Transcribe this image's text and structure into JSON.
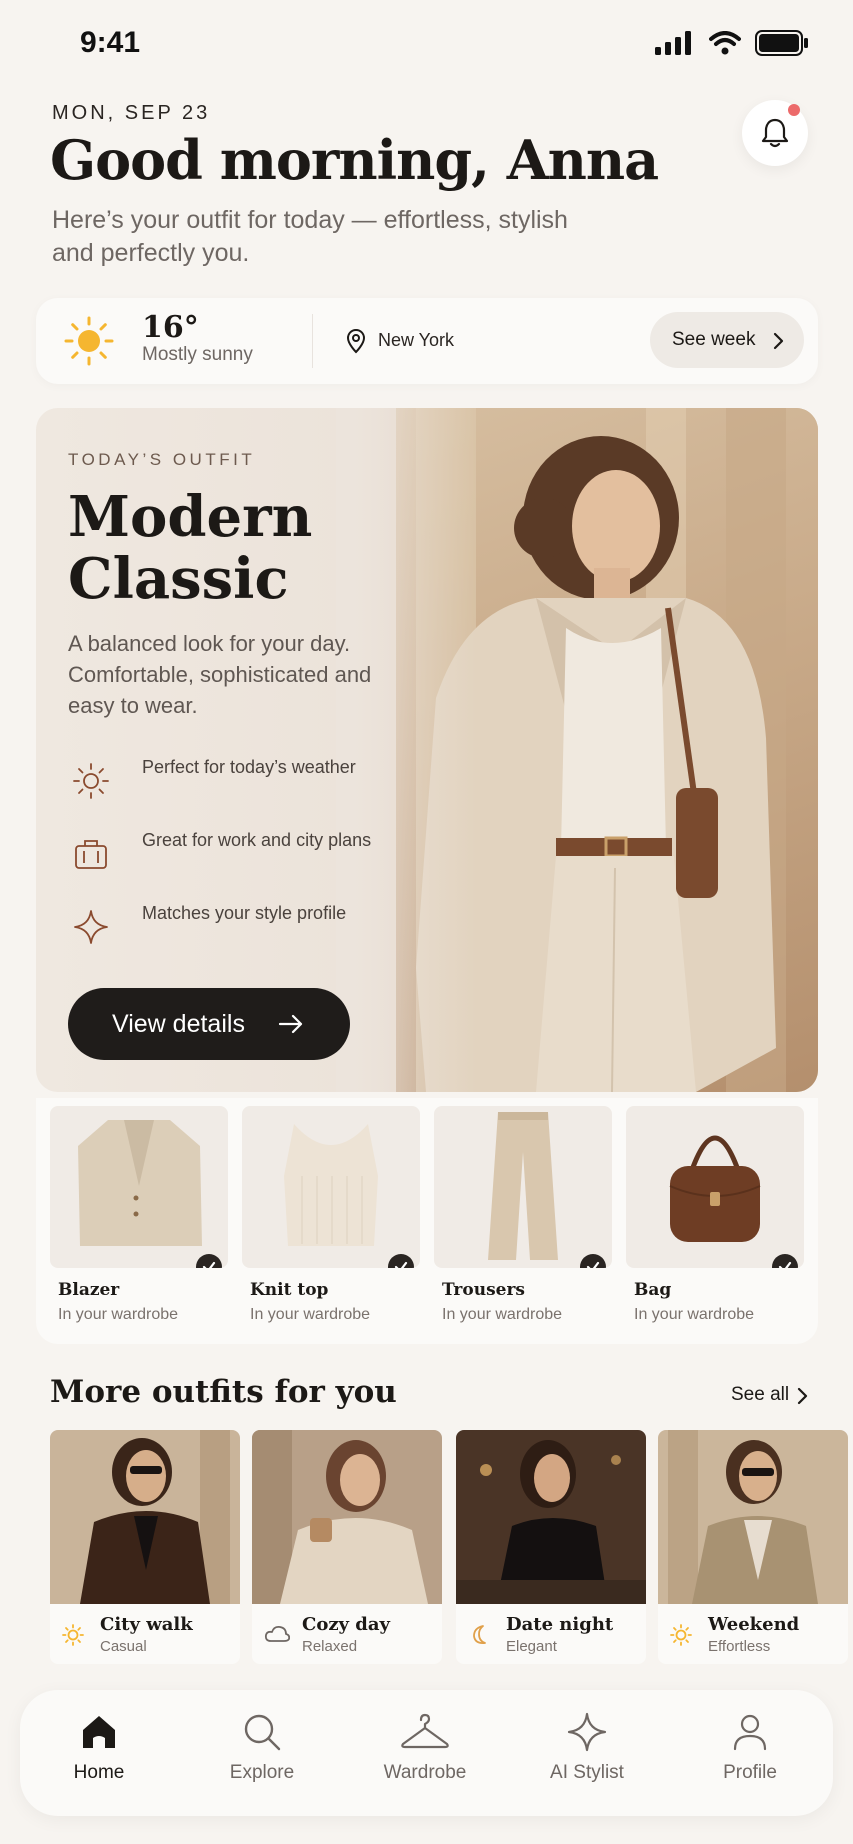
{
  "status_bar": {
    "time": "9:41"
  },
  "header": {
    "date": "MON, SEP 23",
    "greeting": "Good morning, Anna",
    "subtitle": "Here’s your outfit for today — effortless, stylish and perfectly you."
  },
  "weather": {
    "temperature": "16°",
    "condition": "Mostly sunny",
    "location": "New York",
    "see_week_label": "See week"
  },
  "todays_outfit": {
    "eyebrow": "TODAY’S OUTFIT",
    "name": "Modern Classic",
    "description": "A balanced look for your day. Comfortable, sophisticated and easy to wear.",
    "features": [
      {
        "icon": "sun-icon",
        "text": "Perfect for today’s weather"
      },
      {
        "icon": "briefcase-icon",
        "text": "Great for work and city plans"
      },
      {
        "icon": "sparkle-icon",
        "text": "Matches your style profile"
      }
    ],
    "cta_label": "View details"
  },
  "wardrobe_items": [
    {
      "name": "Blazer",
      "status": "In your wardrobe"
    },
    {
      "name": "Knit top",
      "status": "In your wardrobe"
    },
    {
      "name": "Trousers",
      "status": "In your wardrobe"
    },
    {
      "name": "Bag",
      "status": "In your wardrobe"
    }
  ],
  "more_outfits": {
    "title": "More outfits for you",
    "see_all_label": "See all",
    "items": [
      {
        "title": "City walk",
        "subtitle": "Casual",
        "icon": "sun-icon"
      },
      {
        "title": "Cozy day",
        "subtitle": "Relaxed",
        "icon": "cloud-icon"
      },
      {
        "title": "Date night",
        "subtitle": "Elegant",
        "icon": "moon-icon"
      },
      {
        "title": "Weekend",
        "subtitle": "Effortless",
        "icon": "sun-icon"
      }
    ]
  },
  "bottom_nav": [
    {
      "label": "Home",
      "icon": "home-icon",
      "active": true
    },
    {
      "label": "Explore",
      "icon": "search-icon",
      "active": false
    },
    {
      "label": "Wardrobe",
      "icon": "hanger-icon",
      "active": false
    },
    {
      "label": "AI Stylist",
      "icon": "sparkle-icon",
      "active": false
    },
    {
      "label": "Profile",
      "icon": "user-icon",
      "active": false
    }
  ],
  "colors": {
    "background": "#f7f4f0",
    "accent_sun": "#f5b630",
    "notification_dot": "#ec6a6a",
    "button_dark": "#1f1c1a",
    "feature_icon": "#8a4a2e"
  }
}
